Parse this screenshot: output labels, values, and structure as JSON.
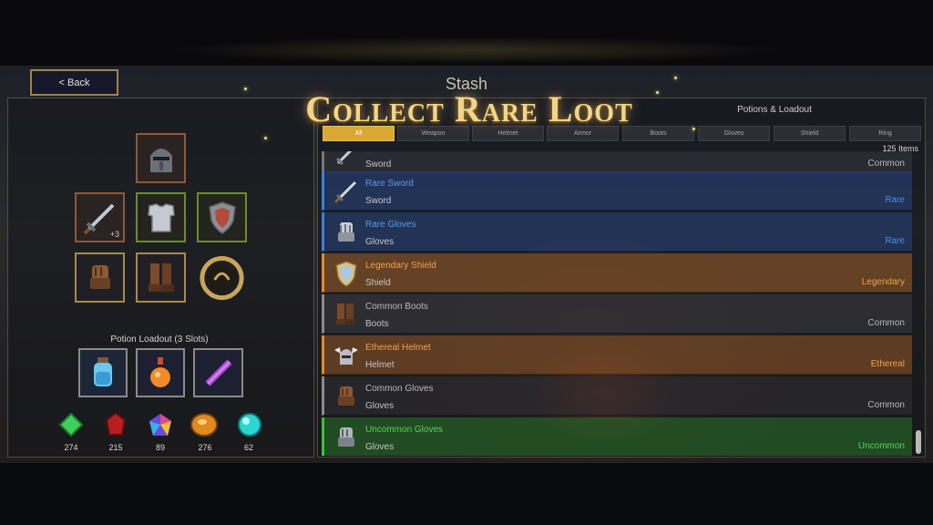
{
  "nav": {
    "back_label": "< Back"
  },
  "header": {
    "stash_title": "Stash",
    "promo_title": "Collect Rare Loot",
    "potions_loadout_label": "Potions & Loadout"
  },
  "filters": {
    "tabs": [
      "All",
      "Weapon",
      "Helmet",
      "Armor",
      "Boots",
      "Gloves",
      "Shield",
      "Ring"
    ],
    "active": "All",
    "item_count": "125 Items"
  },
  "colors": {
    "common": "#b9b9b9",
    "rare": "#4a90e2",
    "legendary": "#e0892c",
    "ethereal": "#e0892c",
    "uncommon": "#4cc44c",
    "accent_gold": "#d9a936"
  },
  "items": [
    {
      "name": "",
      "type": "Sword",
      "rarity": "Common",
      "icon": "sword-icon",
      "style": "common"
    },
    {
      "name": "Rare Sword",
      "type": "Sword",
      "rarity": "Rare",
      "icon": "sword-icon",
      "style": "rare"
    },
    {
      "name": "Rare Gloves",
      "type": "Gloves",
      "rarity": "Rare",
      "icon": "gauntlet-icon",
      "style": "rare"
    },
    {
      "name": "Legendary Shield",
      "type": "Shield",
      "rarity": "Legendary",
      "icon": "shield-icon",
      "style": "legendary"
    },
    {
      "name": "Common Boots",
      "type": "Boots",
      "rarity": "Common",
      "icon": "boots-icon",
      "style": "common"
    },
    {
      "name": "Ethereal Helmet",
      "type": "Helmet",
      "rarity": "Ethereal",
      "icon": "winged-helmet-icon",
      "style": "ethereal"
    },
    {
      "name": "Common Gloves",
      "type": "Gloves",
      "rarity": "Common",
      "icon": "glove-icon",
      "style": "common"
    },
    {
      "name": "Uncommon Gloves",
      "type": "Gloves",
      "rarity": "Uncommon",
      "icon": "gauntlet-icon",
      "style": "uncommon"
    }
  ],
  "equipment": {
    "weapon_upgrade": "+3"
  },
  "potions": {
    "label": "Potion Loadout (3 Slots)",
    "slots": [
      "blue-potion-icon",
      "orange-potion-icon",
      "purple-scroll-icon"
    ]
  },
  "currencies": [
    {
      "icon": "green-gem-icon",
      "count": "274"
    },
    {
      "icon": "red-gem-icon",
      "count": "215"
    },
    {
      "icon": "prismatic-gem-icon",
      "count": "89"
    },
    {
      "icon": "amber-gem-icon",
      "count": "276"
    },
    {
      "icon": "cyan-orb-icon",
      "count": "62"
    }
  ]
}
